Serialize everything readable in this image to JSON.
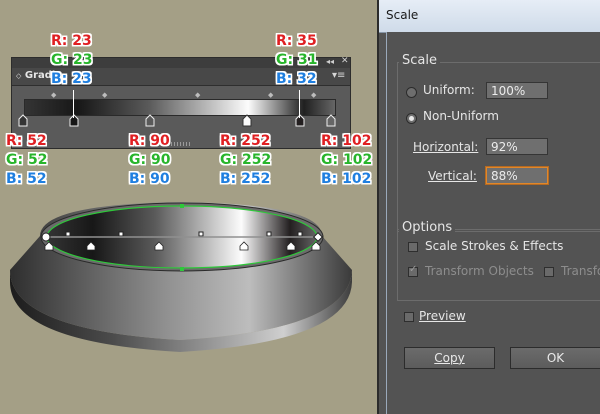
{
  "gradient_panel": {
    "tab_label": "Gradi",
    "stops": [
      {
        "r": "52",
        "g": "52",
        "b": "52"
      },
      {
        "r": "23",
        "g": "23",
        "b": "23"
      },
      {
        "r": "90",
        "g": "90",
        "b": "90"
      },
      {
        "r": "252",
        "g": "252",
        "b": "252"
      },
      {
        "r": "35",
        "g": "31",
        "b": "32"
      },
      {
        "r": "102",
        "g": "102",
        "b": "102"
      }
    ],
    "annotations": [
      {
        "r": "R: 23",
        "g": "G: 23",
        "b": "B: 23"
      },
      {
        "r": "R: 35",
        "g": "G: 31",
        "b": "B: 32"
      },
      {
        "r": "R: 52",
        "g": "G: 52",
        "b": "B: 52"
      },
      {
        "r": "R: 90",
        "g": "G: 90",
        "b": "B: 90"
      },
      {
        "r": "R: 252",
        "g": "G: 252",
        "b": "B: 252"
      },
      {
        "r": "R: 102",
        "g": "G: 102",
        "b": "B: 102"
      }
    ],
    "colors": {
      "r": "#e01f22",
      "g": "#28b52b",
      "b": "#1f7fe0"
    }
  },
  "scale_dialog": {
    "title": "Scale",
    "scale_group": {
      "title": "Scale",
      "uniform_label": "Uniform:",
      "uniform_value": "100%",
      "nonuniform_label": "Non-Uniform",
      "horizontal_label": "Horizontal:",
      "horizontal_value": "92%",
      "vertical_label": "Vertical:",
      "vertical_value": "88%",
      "selected": "Non-Uniform"
    },
    "options_group": {
      "title": "Options",
      "scale_strokes_label": "Scale Strokes & Effects",
      "transform_objects_label": "Transform Objects",
      "transform_patterns_label": "Transform"
    },
    "preview_label": "Preview",
    "copy_label": "Copy",
    "ok_label": "OK"
  }
}
